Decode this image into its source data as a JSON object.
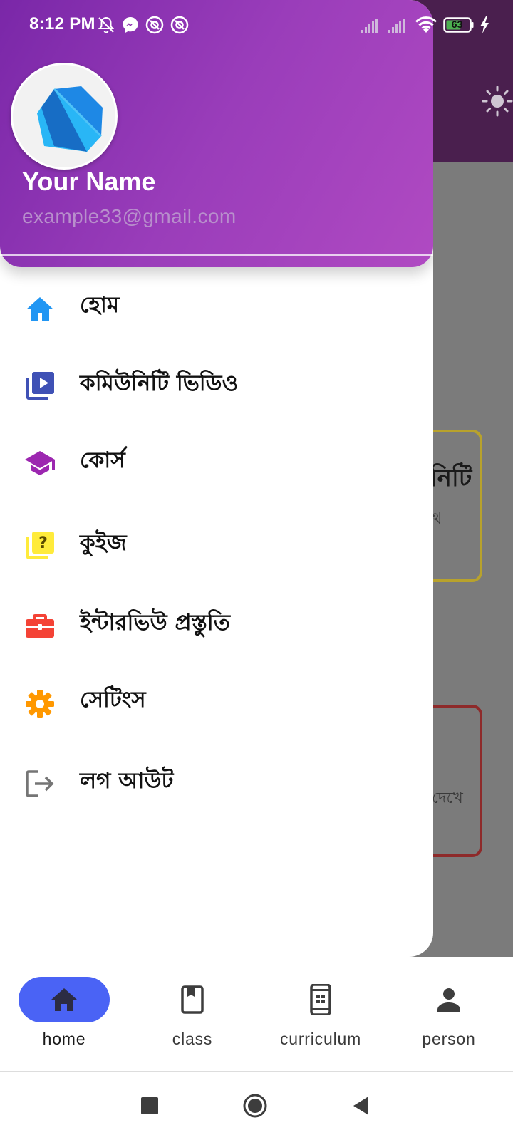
{
  "status_bar": {
    "time": "8:12 PM",
    "battery_level": "63",
    "icons": [
      "notifications-off-icon",
      "messenger-icon",
      "at-sign-icon",
      "at-sign-icon",
      "signal-icon",
      "signal-icon",
      "wifi-icon",
      "battery-icon",
      "charging-icon"
    ]
  },
  "drawer": {
    "user": {
      "name": "Your Name",
      "email": "example33@gmail.com",
      "avatar_icon": "dart-logo-icon"
    },
    "items": [
      {
        "label": "হোম",
        "icon": "home-icon",
        "color": "#2196f3"
      },
      {
        "label": "কমিউনিটি ভিডিও",
        "icon": "video-library-icon",
        "color": "#3f51b5"
      },
      {
        "label": "কোর্স",
        "icon": "school-icon",
        "color": "#9c27b0"
      },
      {
        "label": "কুইজ",
        "icon": "quiz-icon",
        "color": "#ffeb3b"
      },
      {
        "label": "ইন্টারভিউ প্রস্তুতি",
        "icon": "work-icon",
        "color": "#f44336"
      },
      {
        "label": "সেটিংস",
        "icon": "settings-icon",
        "color": "#ff9800"
      },
      {
        "label": "লগ আউট",
        "icon": "logout-icon",
        "color": "#757575"
      }
    ],
    "header_gradient": [
      "#7a27a8",
      "#b04ac2"
    ]
  },
  "background": {
    "card_1": {
      "title": "নিটি",
      "subtitle": "থ"
    },
    "card_2": {
      "subtitle": "দেখে"
    },
    "theme_toggle_icon": "sun-icon"
  },
  "bottom_nav": {
    "items": [
      {
        "label": "home",
        "icon": "home-icon",
        "active": true
      },
      {
        "label": "class",
        "icon": "book-icon",
        "active": false
      },
      {
        "label": "curriculum",
        "icon": "phone-icon",
        "active": false
      },
      {
        "label": "person",
        "icon": "person-icon",
        "active": false
      }
    ],
    "active_color": "#4a63f5"
  },
  "system_nav": {
    "buttons": [
      "recents-button",
      "home-button",
      "back-button"
    ]
  }
}
